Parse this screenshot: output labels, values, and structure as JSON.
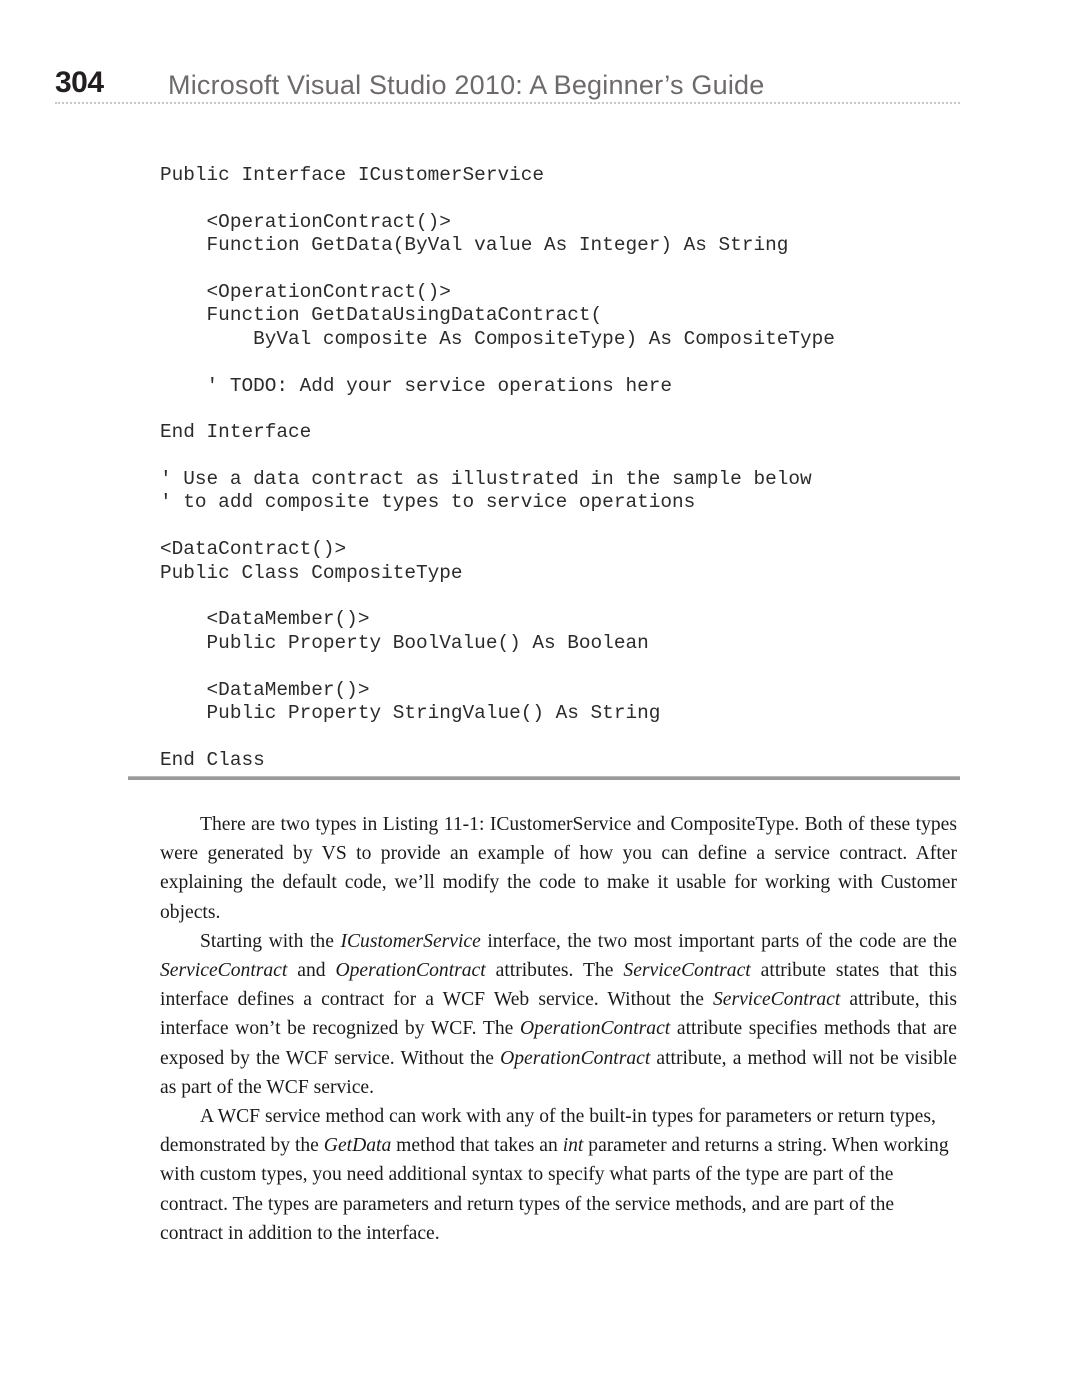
{
  "header": {
    "page_number": "304",
    "title": "Microsoft Visual Studio 2010: A Beginner’s Guide",
    "rule_color": "#c8c6c7"
  },
  "code_listing": {
    "language": "Visual Basic",
    "lines": [
      "Public Interface ICustomerService",
      "",
      "    <OperationContract()>",
      "    Function GetData(ByVal value As Integer) As String",
      "",
      "    <OperationContract()>",
      "    Function GetDataUsingDataContract(",
      "        ByVal composite As CompositeType) As CompositeType",
      "",
      "    ' TODO: Add your service operations here",
      "",
      "End Interface",
      "",
      "' Use a data contract as illustrated in the sample below",
      "' to add composite types to service operations",
      "",
      "<DataContract()>",
      "Public Class CompositeType",
      "",
      "    <DataMember()>",
      "    Public Property BoolValue() As Boolean",
      "",
      "    <DataMember()>",
      "    Public Property StringValue() As String",
      "",
      "End Class"
    ]
  },
  "divider": {
    "color": "#9a9a9a"
  },
  "body": {
    "paragraphs": [
      {
        "id": "paragraph-listing-types",
        "runs": [
          {
            "text": "There are two types in Listing 11-1: ICustomerService and CompositeType. Both of these types were generated by VS to provide an example of how you can define a service contract. After explaining the default code, we’ll modify the code to make it usable for working with Customer objects.",
            "style": "normal"
          }
        ]
      },
      {
        "id": "paragraph-service-contract",
        "runs": [
          {
            "text": "Starting with the ",
            "style": "normal"
          },
          {
            "text": "ICustomerService",
            "style": "italic"
          },
          {
            "text": " interface, the two most important parts of the code are the ",
            "style": "normal"
          },
          {
            "text": "ServiceContract",
            "style": "italic"
          },
          {
            "text": " and ",
            "style": "normal"
          },
          {
            "text": "OperationContract",
            "style": "italic"
          },
          {
            "text": " attributes. The ",
            "style": "normal"
          },
          {
            "text": "ServiceContract",
            "style": "italic"
          },
          {
            "text": " attribute states that this interface defines a contract for a WCF Web service. Without the ",
            "style": "normal"
          },
          {
            "text": "ServiceContract",
            "style": "italic"
          },
          {
            "text": " attribute, this interface won’t be recognized by WCF. The ",
            "style": "normal"
          },
          {
            "text": "OperationContract",
            "style": "italic"
          },
          {
            "text": " attribute specifies methods that are exposed by the WCF service. Without the ",
            "style": "normal"
          },
          {
            "text": "OperationContract",
            "style": "italic"
          },
          {
            "text": " attribute, a method will not be visible as part of the WCF service.",
            "style": "normal"
          }
        ]
      },
      {
        "id": "paragraph-builtin-types",
        "runs": [
          {
            "text": "A WCF service method can work with any of the built-in types for parameters or return types, demonstrated by the ",
            "style": "normal"
          },
          {
            "text": "GetData",
            "style": "italic"
          },
          {
            "text": " method that takes an ",
            "style": "normal"
          },
          {
            "text": "int",
            "style": "italic"
          },
          {
            "text": " parameter and returns a string. When working with custom types, you need additional syntax to specify what parts of the type are part of the contract. The types are parameters and return types of the service methods, and are part of the contract in addition to the interface.",
            "style": "normal"
          }
        ]
      }
    ]
  }
}
